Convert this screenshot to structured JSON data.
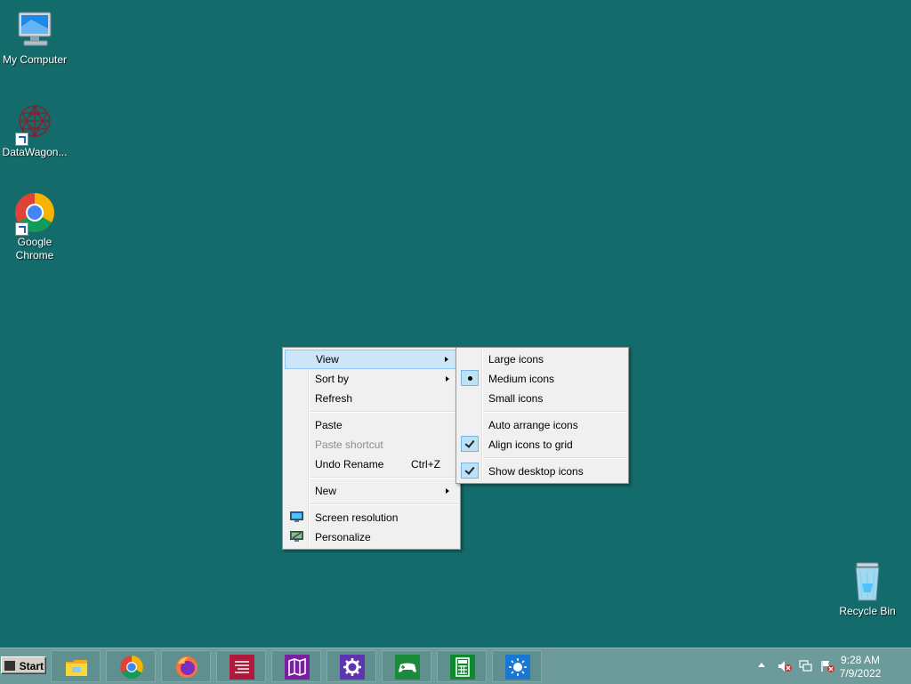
{
  "desktop": {
    "icons": [
      {
        "label": "My Computer"
      },
      {
        "label": "DataWagon..."
      },
      {
        "label": "Google Chrome"
      },
      {
        "label": "Recycle Bin"
      }
    ]
  },
  "context_menu": {
    "items": [
      {
        "label": "View",
        "submenu": true,
        "highlighted": true
      },
      {
        "label": "Sort by",
        "submenu": true
      },
      {
        "label": "Refresh"
      },
      {
        "label": "Paste"
      },
      {
        "label": "Paste shortcut",
        "disabled": true
      },
      {
        "label": "Undo Rename",
        "shortcut": "Ctrl+Z"
      },
      {
        "label": "New",
        "submenu": true
      },
      {
        "label": "Screen resolution",
        "icon": "monitor-icon"
      },
      {
        "label": "Personalize",
        "icon": "personalize-icon"
      }
    ]
  },
  "view_submenu": {
    "items": [
      {
        "label": "Large icons"
      },
      {
        "label": "Medium icons",
        "state": "selected"
      },
      {
        "label": "Small icons"
      },
      {
        "label": "Auto arrange icons"
      },
      {
        "label": "Align icons to grid",
        "state": "checked"
      },
      {
        "label": "Show desktop icons",
        "state": "checked"
      }
    ]
  },
  "taskbar": {
    "start_label": "Start",
    "buttons": [
      {
        "icon": "file-explorer-icon"
      },
      {
        "icon": "chrome-icon"
      },
      {
        "icon": "firefox-icon"
      },
      {
        "icon": "text-editor-icon"
      },
      {
        "icon": "maps-icon"
      },
      {
        "icon": "settings-icon"
      },
      {
        "icon": "games-icon"
      },
      {
        "icon": "calculator-icon"
      },
      {
        "icon": "weather-icon"
      }
    ],
    "clock": {
      "time": "9:28 AM",
      "date": "7/9/2022"
    }
  },
  "colors": {
    "desktop_bg": "#146b6b",
    "taskbar_bg": "#6d9a9a",
    "menu_bg": "#f0f0f0",
    "menu_highlight": "#cde6f7"
  }
}
